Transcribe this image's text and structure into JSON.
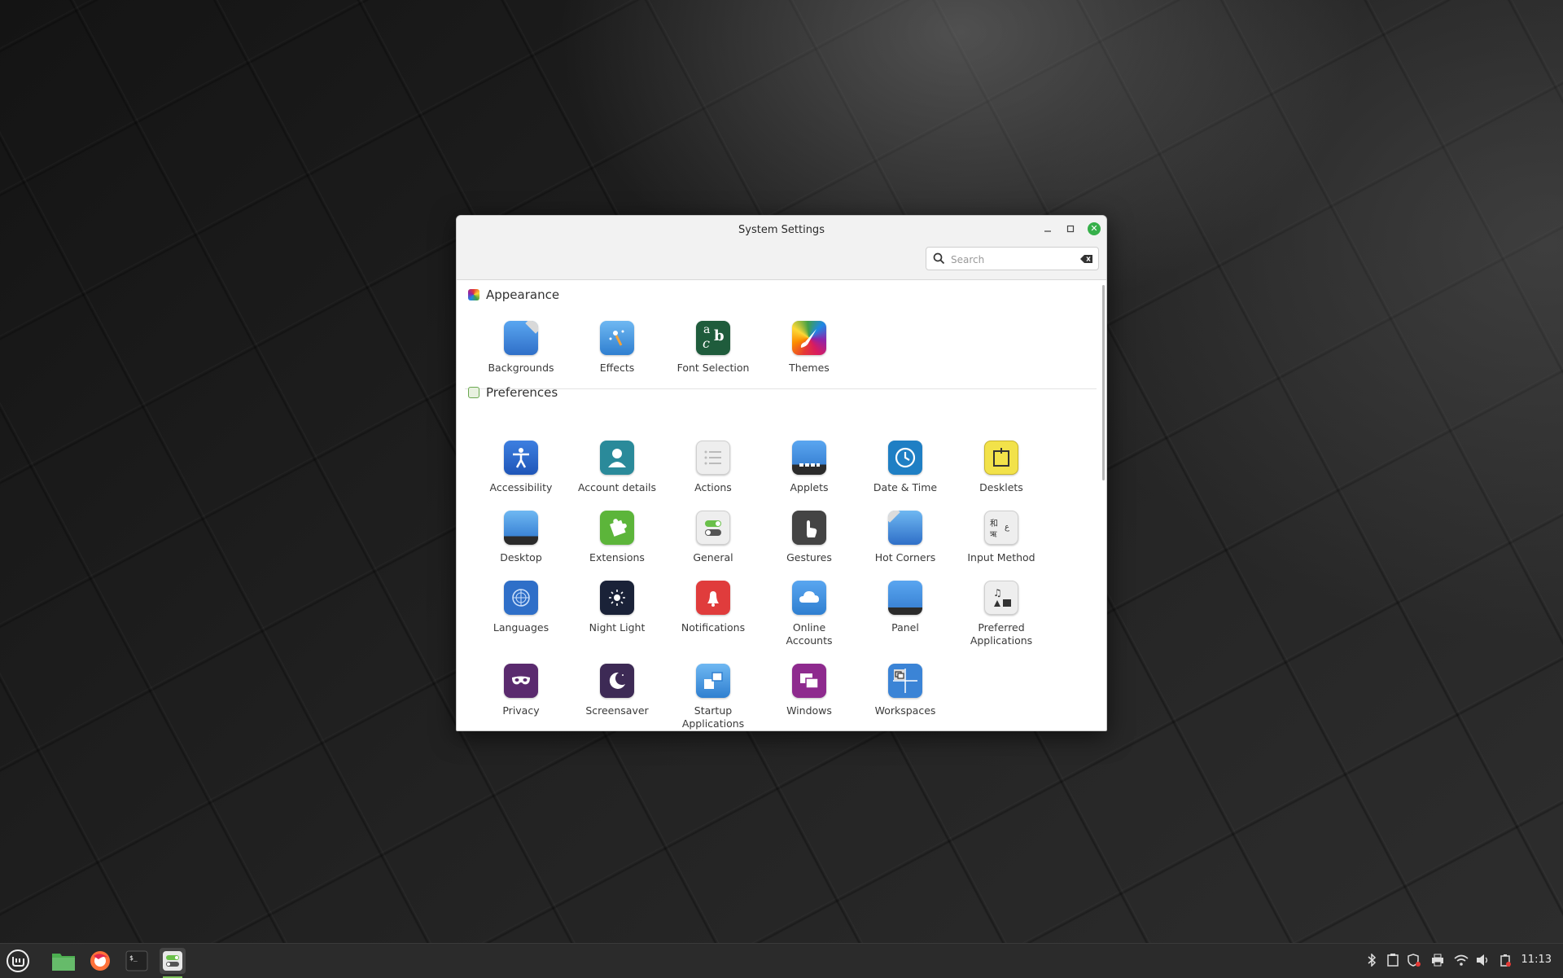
{
  "window": {
    "title": "System Settings",
    "search_placeholder": "Search"
  },
  "sections": [
    {
      "title": "Appearance",
      "icon": "appearance-icon",
      "items": [
        {
          "label": "Backgrounds",
          "icon": "backgrounds-icon"
        },
        {
          "label": "Effects",
          "icon": "effects-icon"
        },
        {
          "label": "Font Selection",
          "icon": "font-selection-icon"
        },
        {
          "label": "Themes",
          "icon": "themes-icon"
        }
      ]
    },
    {
      "title": "Preferences",
      "icon": "preferences-icon",
      "items": [
        {
          "label": "Accessibility",
          "icon": "accessibility-icon"
        },
        {
          "label": "Account details",
          "icon": "account-details-icon"
        },
        {
          "label": "Actions",
          "icon": "actions-icon"
        },
        {
          "label": "Applets",
          "icon": "applets-icon"
        },
        {
          "label": "Date & Time",
          "icon": "date-time-icon"
        },
        {
          "label": "Desklets",
          "icon": "desklets-icon"
        },
        {
          "label": "Desktop",
          "icon": "desktop-icon"
        },
        {
          "label": "Extensions",
          "icon": "extensions-icon"
        },
        {
          "label": "General",
          "icon": "general-icon"
        },
        {
          "label": "Gestures",
          "icon": "gestures-icon"
        },
        {
          "label": "Hot Corners",
          "icon": "hot-corners-icon"
        },
        {
          "label": "Input Method",
          "icon": "input-method-icon"
        },
        {
          "label": "Languages",
          "icon": "languages-icon"
        },
        {
          "label": "Night Light",
          "icon": "night-light-icon"
        },
        {
          "label": "Notifications",
          "icon": "notifications-icon"
        },
        {
          "label": "Online\nAccounts",
          "icon": "online-accounts-icon"
        },
        {
          "label": "Panel",
          "icon": "panel-icon"
        },
        {
          "label": "Preferred\nApplications",
          "icon": "preferred-applications-icon"
        },
        {
          "label": "Privacy",
          "icon": "privacy-icon"
        },
        {
          "label": "Screensaver",
          "icon": "screensaver-icon"
        },
        {
          "label": "Startup\nApplications",
          "icon": "startup-applications-icon"
        },
        {
          "label": "Windows",
          "icon": "windows-icon"
        },
        {
          "label": "Workspaces",
          "icon": "workspaces-icon"
        }
      ]
    }
  ],
  "taskbar": {
    "apps": [
      "menu-icon",
      "files-icon",
      "firefox-icon",
      "terminal-icon",
      "system-settings-icon"
    ],
    "tray": [
      "bluetooth-icon",
      "clipboard-icon",
      "shield-update-icon",
      "printer-icon",
      "wifi-icon",
      "volume-icon",
      "battery-icon"
    ],
    "clock": "11:13"
  },
  "colors": {
    "accent": "#7fc35b",
    "close_button": "#36b04a",
    "taskbar_bg": "#2b2b2b"
  }
}
